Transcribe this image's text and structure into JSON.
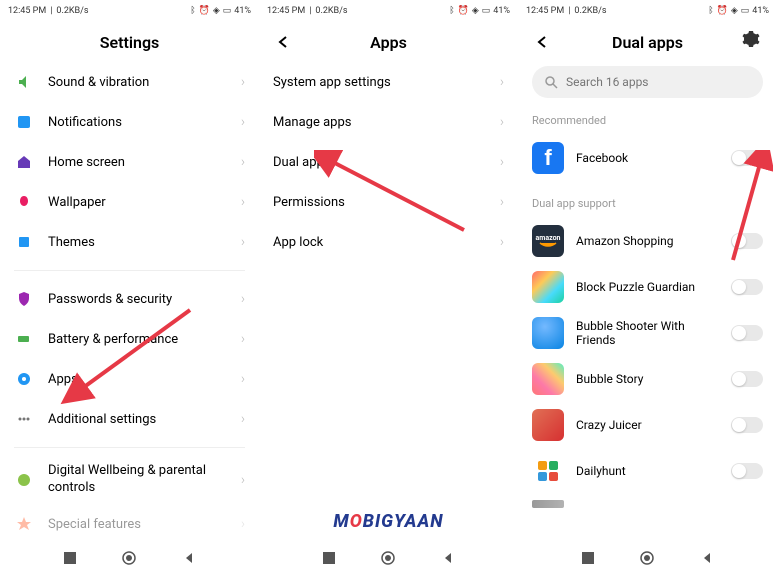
{
  "status": {
    "time": "12:45 PM",
    "speed": "0.2KB/s",
    "battery": "41%"
  },
  "panel1": {
    "title": "Settings",
    "items_a": [
      {
        "label": "Sound & vibration",
        "icon": "sound-icon",
        "color": "#4caf50"
      },
      {
        "label": "Notifications",
        "icon": "notifications-icon",
        "color": "#2196f3"
      },
      {
        "label": "Home screen",
        "icon": "home-icon",
        "color": "#673ab7"
      },
      {
        "label": "Wallpaper",
        "icon": "wallpaper-icon",
        "color": "#e91e63"
      },
      {
        "label": "Themes",
        "icon": "themes-icon",
        "color": "#2196f3"
      }
    ],
    "items_b": [
      {
        "label": "Passwords & security",
        "icon": "security-icon",
        "color": "#9c27b0"
      },
      {
        "label": "Battery & performance",
        "icon": "battery-icon",
        "color": "#4caf50"
      },
      {
        "label": "Apps",
        "icon": "apps-icon",
        "color": "#2196f3"
      },
      {
        "label": "Additional settings",
        "icon": "additional-icon",
        "color": "#757575"
      }
    ],
    "items_c": [
      {
        "label": "Digital Wellbeing & parental controls",
        "icon": "wellbeing-icon",
        "color": "#8bc34a"
      },
      {
        "label": "Special features",
        "icon": "special-icon",
        "color": "#ff5722"
      }
    ]
  },
  "panel2": {
    "title": "Apps",
    "items": [
      {
        "label": "System app settings"
      },
      {
        "label": "Manage apps"
      },
      {
        "label": "Dual apps"
      },
      {
        "label": "Permissions"
      },
      {
        "label": "App lock"
      }
    ]
  },
  "panel3": {
    "title": "Dual apps",
    "search_placeholder": "Search 16 apps",
    "recommended_label": "Recommended",
    "support_label": "Dual app support",
    "recommended": [
      {
        "label": "Facebook"
      }
    ],
    "apps": [
      {
        "label": "Amazon Shopping"
      },
      {
        "label": "Block Puzzle Guardian"
      },
      {
        "label": "Bubble Shooter With Friends"
      },
      {
        "label": "Bubble Story"
      },
      {
        "label": "Crazy Juicer"
      },
      {
        "label": "Dailyhunt"
      }
    ]
  },
  "watermark": "MOBIGYAAN"
}
